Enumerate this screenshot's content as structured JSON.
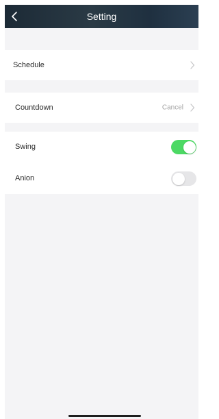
{
  "header": {
    "title": "Setting",
    "back_icon": "chevron-left-icon"
  },
  "rows": {
    "schedule": {
      "label": "Schedule",
      "icon": "chevron-right-icon"
    },
    "countdown": {
      "label": "Countdown",
      "value": "Cancel",
      "icon": "chevron-right-icon"
    },
    "swing": {
      "label": "Swing",
      "enabled": true
    },
    "anion": {
      "label": "Anion",
      "enabled": false
    }
  },
  "colors": {
    "toggle_on": "#4cd964",
    "toggle_off": "#e6e6e8",
    "background": "#f4f4f6"
  }
}
